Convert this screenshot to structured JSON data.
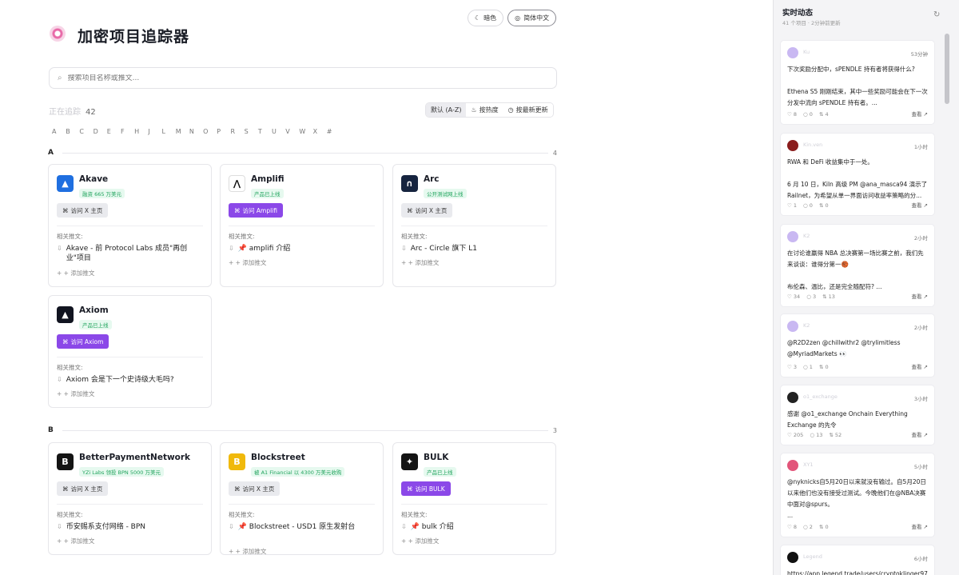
{
  "header": {
    "title": "加密项目追踪器",
    "dark_label": "暗色",
    "lang_label": "简体中文"
  },
  "search": {
    "placeholder": "搜索项目名称或推文..."
  },
  "tracking": {
    "label": "正在追踪",
    "count": "42"
  },
  "sort": {
    "default": "默认 (A-Z)",
    "hot": "按热度",
    "latest": "按最新更新"
  },
  "letters": [
    "A",
    "B",
    "C",
    "D",
    "E",
    "F",
    "H",
    "J",
    "L",
    "M",
    "N",
    "O",
    "P",
    "R",
    "S",
    "T",
    "U",
    "V",
    "W",
    "X",
    "#"
  ],
  "sections": [
    {
      "letter": "A",
      "count": "4"
    },
    {
      "letter": "B",
      "count": "3"
    }
  ],
  "common": {
    "related": "相关推文:",
    "add": "+ + 添加推文"
  },
  "cards": [
    {
      "name": "Akave",
      "badge": "融资 665 万美元",
      "visit": "访问 X 主页",
      "tweet": "Akave - 前 Protocol Labs 成员\"再创业\"项目",
      "color": "#1f6fe0",
      "icon": "▲"
    },
    {
      "name": "Amplifi",
      "badge": "产品已上线",
      "visit": "访问 Amplifi",
      "tweet": "📌 amplifi 介绍",
      "color": "#ffffff",
      "icon": "⋀"
    },
    {
      "name": "Arc",
      "badge": "公开测试网上线",
      "visit": "访问 X 主页",
      "tweet": "Arc - Circle 旗下 L1",
      "color": "#16243f",
      "icon": "∩"
    },
    {
      "name": "Axiom",
      "badge": "产品已上线",
      "visit": "访问 Axiom",
      "tweet": "Axiom 会是下一个史诗级大毛吗?",
      "color": "#111420",
      "icon": "▲"
    },
    {
      "name": "BetterPaymentNetwork",
      "badge": "YZi Labs 领投 BPN 5000 万美元",
      "visit": "访问 X 主页",
      "tweet": "币安赐系支付网络 - BPN",
      "color": "#141414",
      "icon": "B"
    },
    {
      "name": "Blockstreet",
      "badge": "被 A1 Financial 以 4300 万美元收购",
      "visit": "访问 X 主页",
      "tweet": "📌 Blockstreet - USD1 原生发射台",
      "color": "#f0b90b",
      "icon": "B"
    },
    {
      "name": "BULK",
      "badge": "产品已上线",
      "visit": "访问 BULK",
      "tweet": "📌 bulk 介绍",
      "color": "#141414",
      "icon": "✦"
    }
  ],
  "feed": {
    "title": "实时动态",
    "subtitle": "41 个项目 · 2分钟前更新",
    "view": "查看",
    "items": [
      {
        "user": "Ku",
        "time": "53分钟",
        "text": "下次奖励分配中，sPENDLE 持有者将获得什么?\n\nEthena S5 刚刚结束，其中一些奖励可能会在下一次分发中流向 sPENDLE 持有者。...",
        "likes": "8",
        "replies": "0",
        "rts": "4",
        "color": "#c9b8f2"
      },
      {
        "user": "Kin.ven",
        "time": "1小时",
        "text": "RWA 和 DeFi 收益集中于一处。\n\n6 月 10 日，Kiln 高级 PM @ana_masca94 演示了 Railnet，为希望从单一界面访问收益率策略的分...",
        "likes": "1",
        "replies": "0",
        "rts": "0",
        "color": "#8a1d1d"
      },
      {
        "user": "K2",
        "time": "2小时",
        "text": "在讨论谁赢得 NBA 总决赛第一场比赛之前，我们先来谈谈：谁得分第一🏀\n\n布伦森、温比，还是完全随配符? ...",
        "likes": "34",
        "replies": "3",
        "rts": "13",
        "color": "#c9b8f2"
      },
      {
        "user": "K2",
        "time": "2小时",
        "text": "@R2D2zen @chillwithr2 @trylimitless @MyriadMarkets 👀",
        "likes": "3",
        "replies": "1",
        "rts": "0",
        "color": "#c9b8f2"
      },
      {
        "user": "o1_exchange",
        "time": "3小时",
        "text": "感谢 @o1_exchange Onchain Everything Exchange 的先令",
        "likes": "205",
        "replies": "13",
        "rts": "52",
        "color": "#222"
      },
      {
        "user": "XY1",
        "time": "5小时",
        "text": "@nyknicks自5月20日以来就没有输过。自5月20日以来他们也没有接受过测试。今晚他们在@NBA决赛中面对@spurs。\n...",
        "likes": "8",
        "replies": "2",
        "rts": "0",
        "color": "#e2557a"
      },
      {
        "user": "Legend",
        "time": "6小时",
        "text": "https://app.legend.trade/users/cryptoklinger97",
        "likes": "",
        "replies": "",
        "rts": "",
        "color": "#111"
      }
    ]
  }
}
